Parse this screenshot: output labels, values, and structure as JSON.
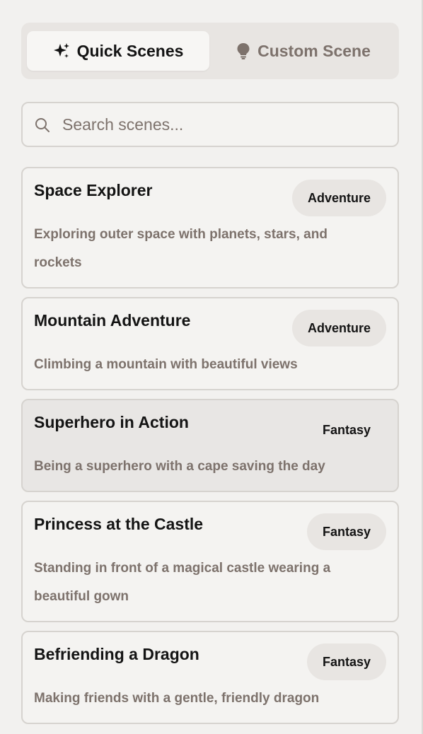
{
  "tabs": {
    "quick": {
      "label": "Quick Scenes",
      "icon": "sparkle-icon"
    },
    "custom": {
      "label": "Custom Scene",
      "icon": "lightbulb-icon"
    }
  },
  "search": {
    "placeholder": "Search scenes...",
    "value": ""
  },
  "scenes": [
    {
      "title": "Space Explorer",
      "category": "Adventure",
      "description": "Exploring outer space with planets, stars, and rockets"
    },
    {
      "title": "Mountain Adventure",
      "category": "Adventure",
      "description": "Climbing a mountain with beautiful views"
    },
    {
      "title": "Superhero in Action",
      "category": "Fantasy",
      "description": "Being a superhero with a cape saving the day"
    },
    {
      "title": "Princess at the Castle",
      "category": "Fantasy",
      "description": "Standing in front of a magical castle wearing a beautiful gown"
    },
    {
      "title": "Befriending a Dragon",
      "category": "Fantasy",
      "description": "Making friends with a gentle, friendly dragon"
    }
  ],
  "colors": {
    "background": "#f2f1ef",
    "muted_text": "#7d726c",
    "badge_bg": "#e8e5e2",
    "border": "#d6d3cf"
  }
}
